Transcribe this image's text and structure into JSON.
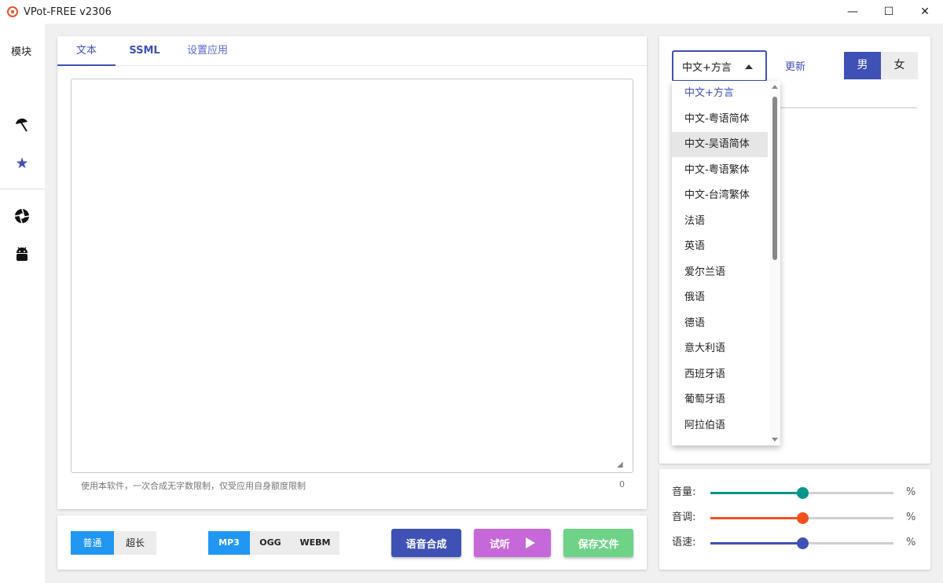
{
  "window": {
    "title": "VPot-FREE v2306",
    "controls": {
      "minimize": "—",
      "maximize": "☐",
      "close": "✕"
    }
  },
  "sidebar": {
    "label": "模块",
    "icons": [
      "umbrella-icon",
      "star-icon",
      "aperture-icon",
      "android-icon"
    ]
  },
  "tabs": [
    {
      "label": "文本",
      "active": true
    },
    {
      "label": "SSML",
      "active": false
    },
    {
      "label": "设置应用",
      "active": false
    }
  ],
  "editor": {
    "value": "",
    "placeholder": "",
    "hint": "使用本软件，一次合成无字数限制，仅受应用自身额度限制",
    "char_count": "0"
  },
  "mode_toggle": {
    "options": [
      "普通",
      "超长"
    ],
    "selected": "普通"
  },
  "format_toggle": {
    "options": [
      "MP3",
      "OGG",
      "WEBM"
    ],
    "selected": "MP3"
  },
  "actions": {
    "synthesize": "语音合成",
    "listen": "试听",
    "save": "保存文件"
  },
  "voice": {
    "language_selected": "中文+方言",
    "update_label": "更新",
    "gender_options": [
      "男",
      "女"
    ],
    "gender_selected": "男"
  },
  "language_options": [
    "中文+方言",
    "中文-粤语简体",
    "中文-吴语简体",
    "中文-粤语繁体",
    "中文-台湾繁体",
    "法语",
    "英语",
    "爱尔兰语",
    "俄语",
    "德语",
    "意大利语",
    "西班牙语",
    "葡萄牙语",
    "阿拉伯语"
  ],
  "language_hovered": "中文-吴语简体",
  "sliders": [
    {
      "label": "音量:",
      "value": 50,
      "unit": "%",
      "color": "#00968a"
    },
    {
      "label": "音调:",
      "value": 50,
      "unit": "%",
      "color": "#f4511e"
    },
    {
      "label": "语速:",
      "value": 50,
      "unit": "%",
      "color": "#3f51b5"
    }
  ]
}
